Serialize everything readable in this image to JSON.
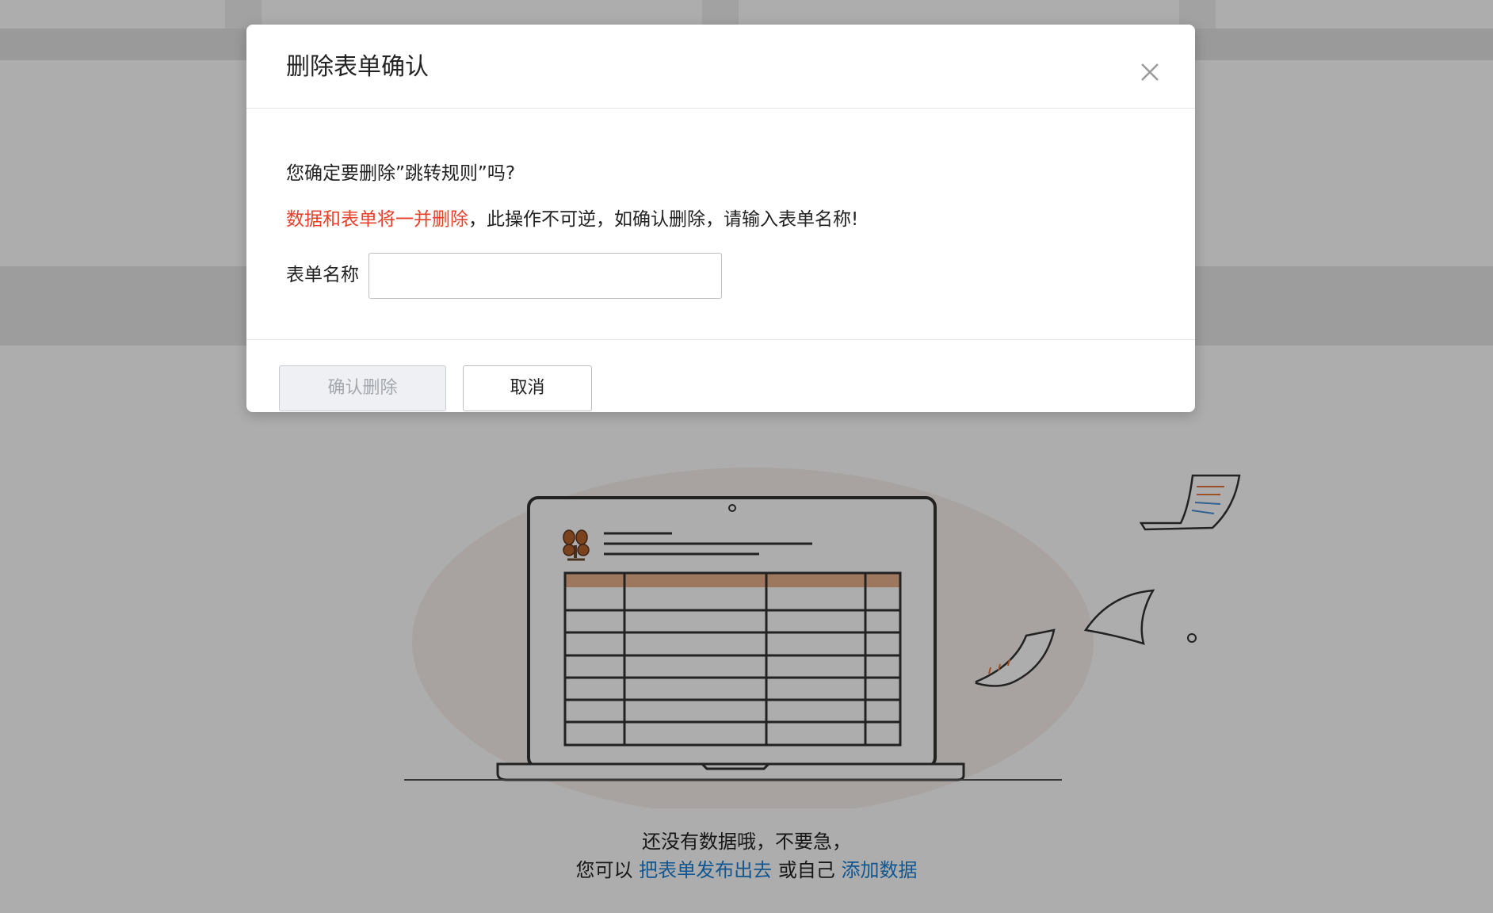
{
  "modal": {
    "title": "删除表单确认",
    "question": "您确定要删除”跳转规则”吗?",
    "warning_red": "数据和表单将一并删除",
    "warning_rest": "，此操作不可逆，如确认删除，请输入表单名称!",
    "field_label": "表单名称",
    "input_value": "",
    "input_placeholder": "",
    "confirm_label": "确认删除",
    "cancel_label": "取消"
  },
  "empty_state": {
    "line1": "还没有数据哦，不要急，",
    "line2_prefix": "您可以",
    "publish_link": "把表单发布出去",
    "line2_middle": "或自己",
    "add_link": "添加数据"
  },
  "colors": {
    "warning": "#e8412b",
    "link": "#1a7fd4",
    "overlay": "rgba(0,0,0,0.32)",
    "table_header": "#e9b08d"
  },
  "icons": {
    "close": "close-icon",
    "illustration": "laptop-table-illustration"
  }
}
